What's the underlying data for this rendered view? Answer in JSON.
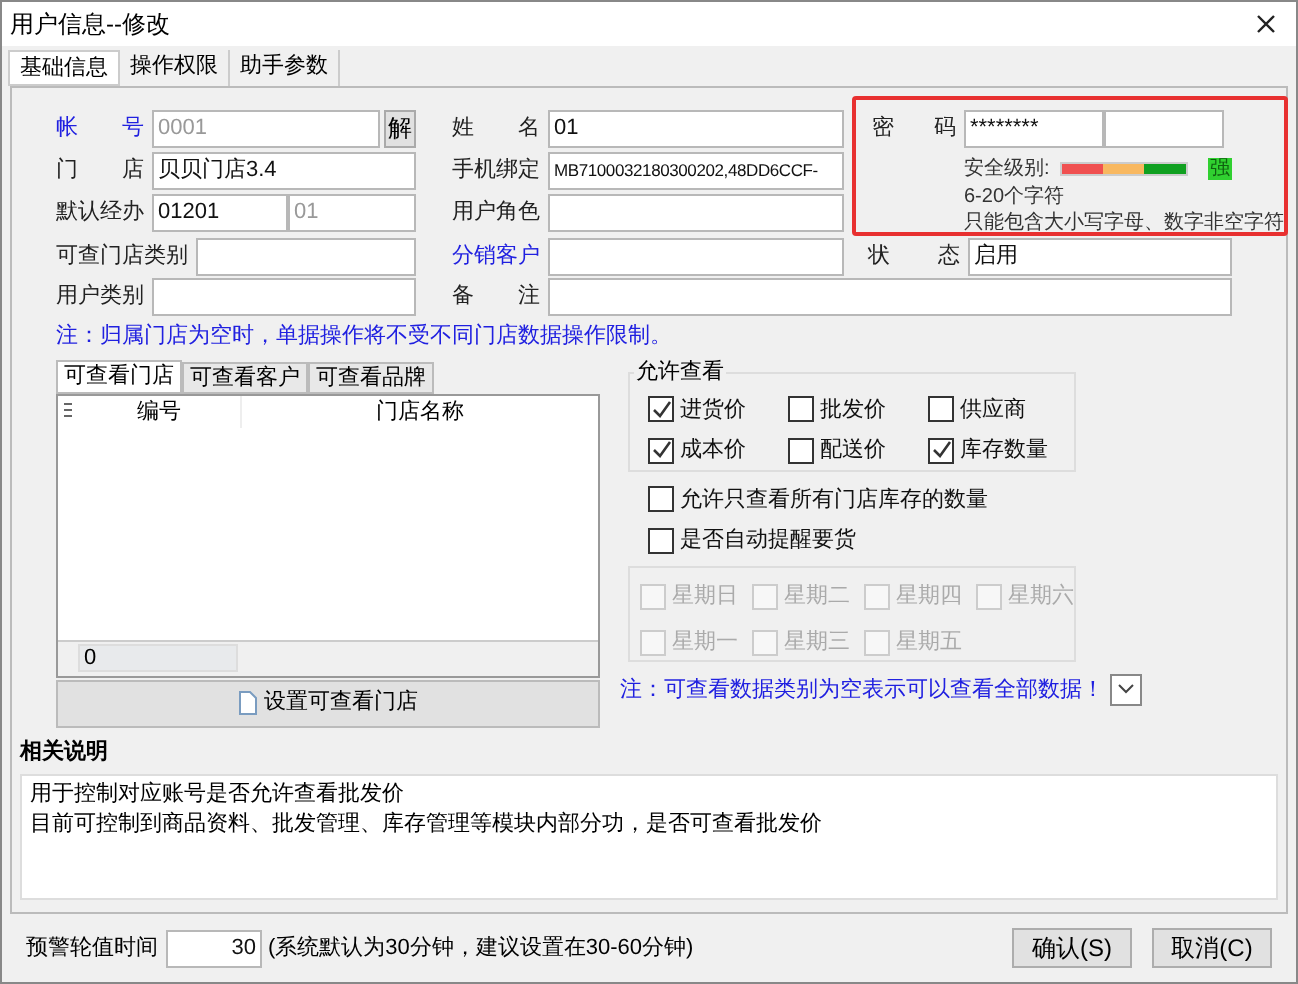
{
  "window": {
    "title": "用户信息--修改"
  },
  "tabs": [
    {
      "label": "基础信息",
      "selected": true
    },
    {
      "label": "操作权限",
      "selected": false
    },
    {
      "label": "助手参数",
      "selected": false
    }
  ],
  "fields_left": [
    {
      "label": "帐号",
      "kind": "link",
      "value": "0001",
      "disabled": true,
      "button": "解"
    },
    {
      "label": "门店",
      "kind": "plain",
      "value": "贝贝门店3.4"
    },
    {
      "label": "默认经办",
      "kind": "plain",
      "value": "01201",
      "value2": "01"
    },
    {
      "label": "可查门店类别",
      "kind": "plain"
    },
    {
      "label": "用户类别",
      "kind": "plain"
    }
  ],
  "fields_right": [
    {
      "label": "姓名",
      "kind": "plain",
      "value": "01"
    },
    {
      "label": "手机绑定",
      "kind": "plain",
      "value": "MB7100032180300202,48DD6CCF-"
    },
    {
      "label": "用户角色",
      "kind": "plain"
    },
    {
      "label": "分销客户",
      "kind": "link"
    },
    {
      "label": "备注",
      "kind": "plain"
    }
  ],
  "password": {
    "label": "密码",
    "value": "********",
    "strength_label": "安全级别:",
    "level": 1,
    "strength_text": "强",
    "hints": [
      "6-20个字符",
      "只能包含大小写字母、数字非空字符"
    ]
  },
  "status": {
    "label": "状态",
    "value": "启用"
  },
  "note": "注：归属门店为空时，单据操作将不受不同门店数据操作限制。",
  "store_tabs": [
    {
      "label": "可查看门店",
      "selected": true
    },
    {
      "label": "可查看客户",
      "selected": false
    },
    {
      "label": "可查看品牌",
      "selected": false
    }
  ],
  "store_table": {
    "columns": [
      "编号",
      "门店名称"
    ],
    "count": "0"
  },
  "set_store_button": "设置可查看门店",
  "allow_view": {
    "title": "允许查看",
    "options": [
      {
        "label": "进货价",
        "checked": true
      },
      {
        "label": "批发价",
        "checked": false
      },
      {
        "label": "供应商",
        "checked": false
      },
      {
        "label": "成本价",
        "checked": true
      },
      {
        "label": "配送价",
        "checked": false
      },
      {
        "label": "库存数量",
        "checked": true
      }
    ]
  },
  "extra_options": [
    {
      "label": "允许只查看所有门店库存的数量",
      "checked": false
    },
    {
      "label": "是否自动提醒要货",
      "checked": false
    }
  ],
  "weekdays": {
    "disabled": true,
    "days": [
      {
        "label": "星期日",
        "checked": false
      },
      {
        "label": "星期二",
        "checked": false
      },
      {
        "label": "星期四",
        "checked": false
      },
      {
        "label": "星期六",
        "checked": false
      },
      {
        "label": "星期一",
        "checked": false
      },
      {
        "label": "星期三",
        "checked": false
      },
      {
        "label": "星期五",
        "checked": false
      }
    ]
  },
  "data_note": "注：可查看数据类别为空表示可以查看全部数据！",
  "description": {
    "title": "相关说明",
    "lines": [
      "用于控制对应账号是否允许查看批发价",
      "目前可控制到商品资料、批发管理、库存管理等模块内部分功，是否可查看批发价"
    ]
  },
  "footer": {
    "interval_label": "预警轮值时间",
    "interval_value": "30",
    "interval_hint": "(系统默认为30分钟，建议设置在30-60分钟)",
    "buttons": [
      "确认(S)",
      "取消(C)"
    ]
  }
}
